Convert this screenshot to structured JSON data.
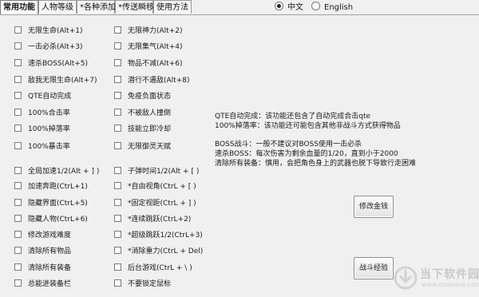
{
  "tabs": [
    {
      "label": "常用功能",
      "active": true
    },
    {
      "label": "人物等级",
      "active": false
    },
    {
      "label": "*各种添加",
      "active": false
    },
    {
      "label": "*传送瞬移",
      "active": false
    },
    {
      "label": "使用方法",
      "active": false
    }
  ],
  "language": {
    "chinese": "中文",
    "english": "English",
    "selected": "中文"
  },
  "left_col_top": [
    "无限生命(Alt+1)",
    "一击必杀(Alt+3)",
    "速杀BOSS(Alt+5)",
    "敌我无限生命(Alt+7)",
    "QTE自动完成",
    "100%合击率",
    "100%掉落率",
    "100%暴击率"
  ],
  "mid_col_top": [
    "无限神力(Alt+2)",
    "无限集气(Alt+4)",
    "物品不减(Alt+6)",
    "潜行不遇敌(Alt+8)",
    "免疫负面状态",
    "不被敌人撞倒",
    "技能立即冷却",
    "无限御灵天赋"
  ],
  "left_col_bottom": [
    "全局加速1/2(Alt + ] )",
    "加速奔跑(CtrL+1)",
    "隐藏界面(CtrL+5)",
    "隐藏人物(CtrL+6)",
    "修改游戏难度",
    "清除所有物品",
    "清除所有装备",
    "总能进装备栏"
  ],
  "mid_col_bottom": [
    "子弹时间1/2(Alt + [ )",
    "*自由视角(CtrL + [ )",
    "*固定视距(CtrL + ] )",
    "*连续跳跃(CtrL+2)",
    "*超级跳跃1/2(CtrL+3)",
    "*消除重力(CtrL + Del)",
    "后台游戏(CtrL + \\ )",
    "不要锁定鼠标"
  ],
  "notes": {
    "line1": "QTE自动完成：该功能还包含了自动完成合击qte",
    "line2": "100%掉落率：该功能还可能包含其他非战斗方式获得物品",
    "line3": "BOSS战斗：一般不建议对BOSS使用一击必杀",
    "line4": "速杀BOSS：每次伤害为剩余血量的1/20，直到小于2000",
    "line5": "清除所有装备：慎用，会把角色身上的武器也脱下导致行走困难"
  },
  "buttons": {
    "modify_money": "修改金钱",
    "battle_exp": "战斗经验"
  },
  "watermark": {
    "title": "当下软件园",
    "url": "www.downxia.com"
  }
}
